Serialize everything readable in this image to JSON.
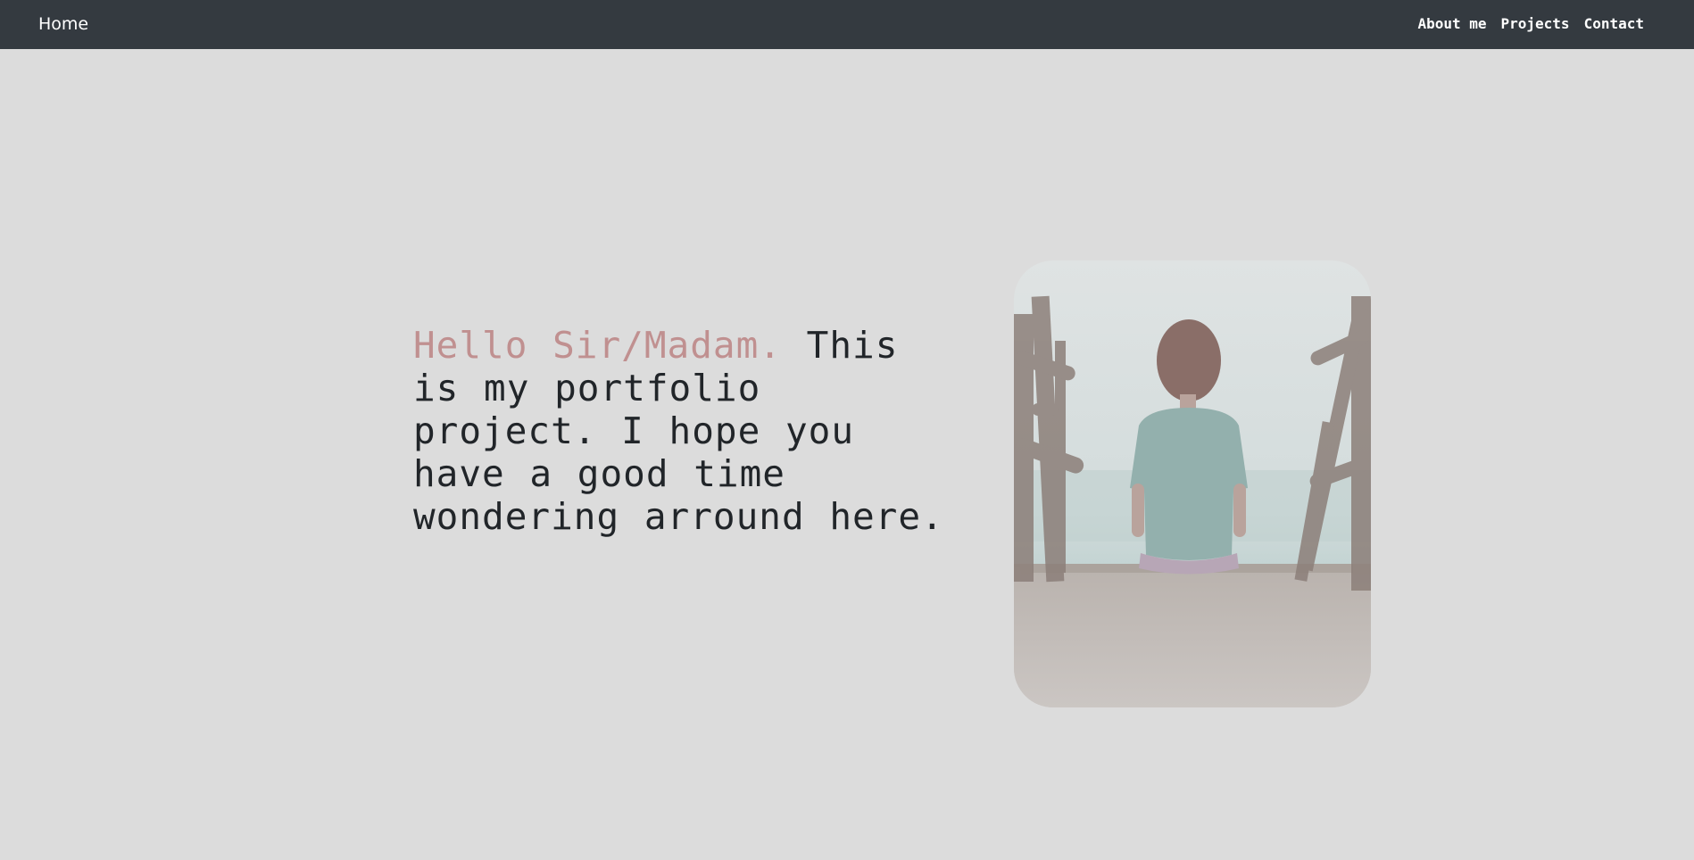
{
  "navbar": {
    "brand": "Home",
    "links": [
      "About me",
      "Projects",
      "Contact"
    ],
    "background": "#343a40"
  },
  "hero": {
    "greeting": "Hello Sir/Madam.",
    "message": "This is my portfolio project. I hope you have a good time wondering arround here.",
    "greeting_color": "#c09090",
    "text_color": "#212529"
  },
  "colors": {
    "page_background": "#dcdcdc"
  }
}
